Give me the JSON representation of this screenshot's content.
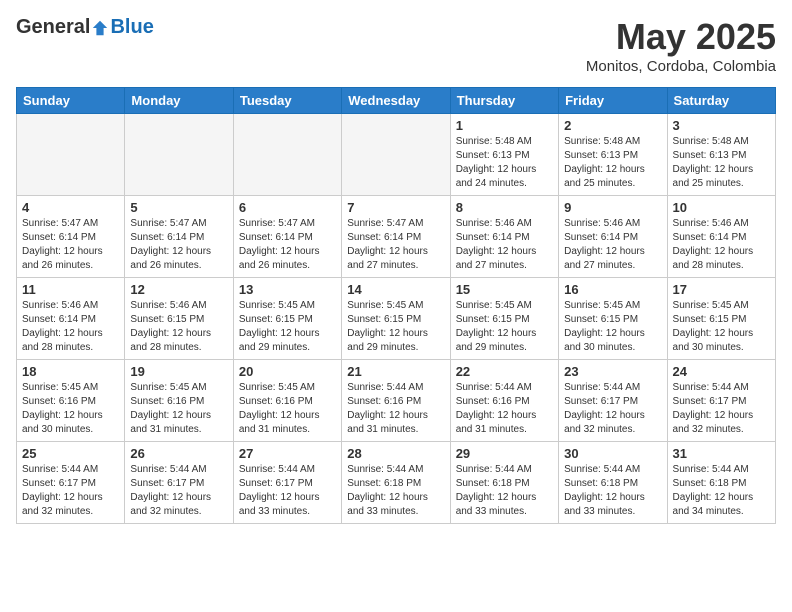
{
  "header": {
    "logo_general": "General",
    "logo_blue": "Blue",
    "month": "May 2025",
    "location": "Monitos, Cordoba, Colombia"
  },
  "days_of_week": [
    "Sunday",
    "Monday",
    "Tuesday",
    "Wednesday",
    "Thursday",
    "Friday",
    "Saturday"
  ],
  "weeks": [
    [
      {
        "day": "",
        "info": ""
      },
      {
        "day": "",
        "info": ""
      },
      {
        "day": "",
        "info": ""
      },
      {
        "day": "",
        "info": ""
      },
      {
        "day": "1",
        "info": "Sunrise: 5:48 AM\nSunset: 6:13 PM\nDaylight: 12 hours\nand 24 minutes."
      },
      {
        "day": "2",
        "info": "Sunrise: 5:48 AM\nSunset: 6:13 PM\nDaylight: 12 hours\nand 25 minutes."
      },
      {
        "day": "3",
        "info": "Sunrise: 5:48 AM\nSunset: 6:13 PM\nDaylight: 12 hours\nand 25 minutes."
      }
    ],
    [
      {
        "day": "4",
        "info": "Sunrise: 5:47 AM\nSunset: 6:14 PM\nDaylight: 12 hours\nand 26 minutes."
      },
      {
        "day": "5",
        "info": "Sunrise: 5:47 AM\nSunset: 6:14 PM\nDaylight: 12 hours\nand 26 minutes."
      },
      {
        "day": "6",
        "info": "Sunrise: 5:47 AM\nSunset: 6:14 PM\nDaylight: 12 hours\nand 26 minutes."
      },
      {
        "day": "7",
        "info": "Sunrise: 5:47 AM\nSunset: 6:14 PM\nDaylight: 12 hours\nand 27 minutes."
      },
      {
        "day": "8",
        "info": "Sunrise: 5:46 AM\nSunset: 6:14 PM\nDaylight: 12 hours\nand 27 minutes."
      },
      {
        "day": "9",
        "info": "Sunrise: 5:46 AM\nSunset: 6:14 PM\nDaylight: 12 hours\nand 27 minutes."
      },
      {
        "day": "10",
        "info": "Sunrise: 5:46 AM\nSunset: 6:14 PM\nDaylight: 12 hours\nand 28 minutes."
      }
    ],
    [
      {
        "day": "11",
        "info": "Sunrise: 5:46 AM\nSunset: 6:14 PM\nDaylight: 12 hours\nand 28 minutes."
      },
      {
        "day": "12",
        "info": "Sunrise: 5:46 AM\nSunset: 6:15 PM\nDaylight: 12 hours\nand 28 minutes."
      },
      {
        "day": "13",
        "info": "Sunrise: 5:45 AM\nSunset: 6:15 PM\nDaylight: 12 hours\nand 29 minutes."
      },
      {
        "day": "14",
        "info": "Sunrise: 5:45 AM\nSunset: 6:15 PM\nDaylight: 12 hours\nand 29 minutes."
      },
      {
        "day": "15",
        "info": "Sunrise: 5:45 AM\nSunset: 6:15 PM\nDaylight: 12 hours\nand 29 minutes."
      },
      {
        "day": "16",
        "info": "Sunrise: 5:45 AM\nSunset: 6:15 PM\nDaylight: 12 hours\nand 30 minutes."
      },
      {
        "day": "17",
        "info": "Sunrise: 5:45 AM\nSunset: 6:15 PM\nDaylight: 12 hours\nand 30 minutes."
      }
    ],
    [
      {
        "day": "18",
        "info": "Sunrise: 5:45 AM\nSunset: 6:16 PM\nDaylight: 12 hours\nand 30 minutes."
      },
      {
        "day": "19",
        "info": "Sunrise: 5:45 AM\nSunset: 6:16 PM\nDaylight: 12 hours\nand 31 minutes."
      },
      {
        "day": "20",
        "info": "Sunrise: 5:45 AM\nSunset: 6:16 PM\nDaylight: 12 hours\nand 31 minutes."
      },
      {
        "day": "21",
        "info": "Sunrise: 5:44 AM\nSunset: 6:16 PM\nDaylight: 12 hours\nand 31 minutes."
      },
      {
        "day": "22",
        "info": "Sunrise: 5:44 AM\nSunset: 6:16 PM\nDaylight: 12 hours\nand 31 minutes."
      },
      {
        "day": "23",
        "info": "Sunrise: 5:44 AM\nSunset: 6:17 PM\nDaylight: 12 hours\nand 32 minutes."
      },
      {
        "day": "24",
        "info": "Sunrise: 5:44 AM\nSunset: 6:17 PM\nDaylight: 12 hours\nand 32 minutes."
      }
    ],
    [
      {
        "day": "25",
        "info": "Sunrise: 5:44 AM\nSunset: 6:17 PM\nDaylight: 12 hours\nand 32 minutes."
      },
      {
        "day": "26",
        "info": "Sunrise: 5:44 AM\nSunset: 6:17 PM\nDaylight: 12 hours\nand 32 minutes."
      },
      {
        "day": "27",
        "info": "Sunrise: 5:44 AM\nSunset: 6:17 PM\nDaylight: 12 hours\nand 33 minutes."
      },
      {
        "day": "28",
        "info": "Sunrise: 5:44 AM\nSunset: 6:18 PM\nDaylight: 12 hours\nand 33 minutes."
      },
      {
        "day": "29",
        "info": "Sunrise: 5:44 AM\nSunset: 6:18 PM\nDaylight: 12 hours\nand 33 minutes."
      },
      {
        "day": "30",
        "info": "Sunrise: 5:44 AM\nSunset: 6:18 PM\nDaylight: 12 hours\nand 33 minutes."
      },
      {
        "day": "31",
        "info": "Sunrise: 5:44 AM\nSunset: 6:18 PM\nDaylight: 12 hours\nand 34 minutes."
      }
    ]
  ]
}
